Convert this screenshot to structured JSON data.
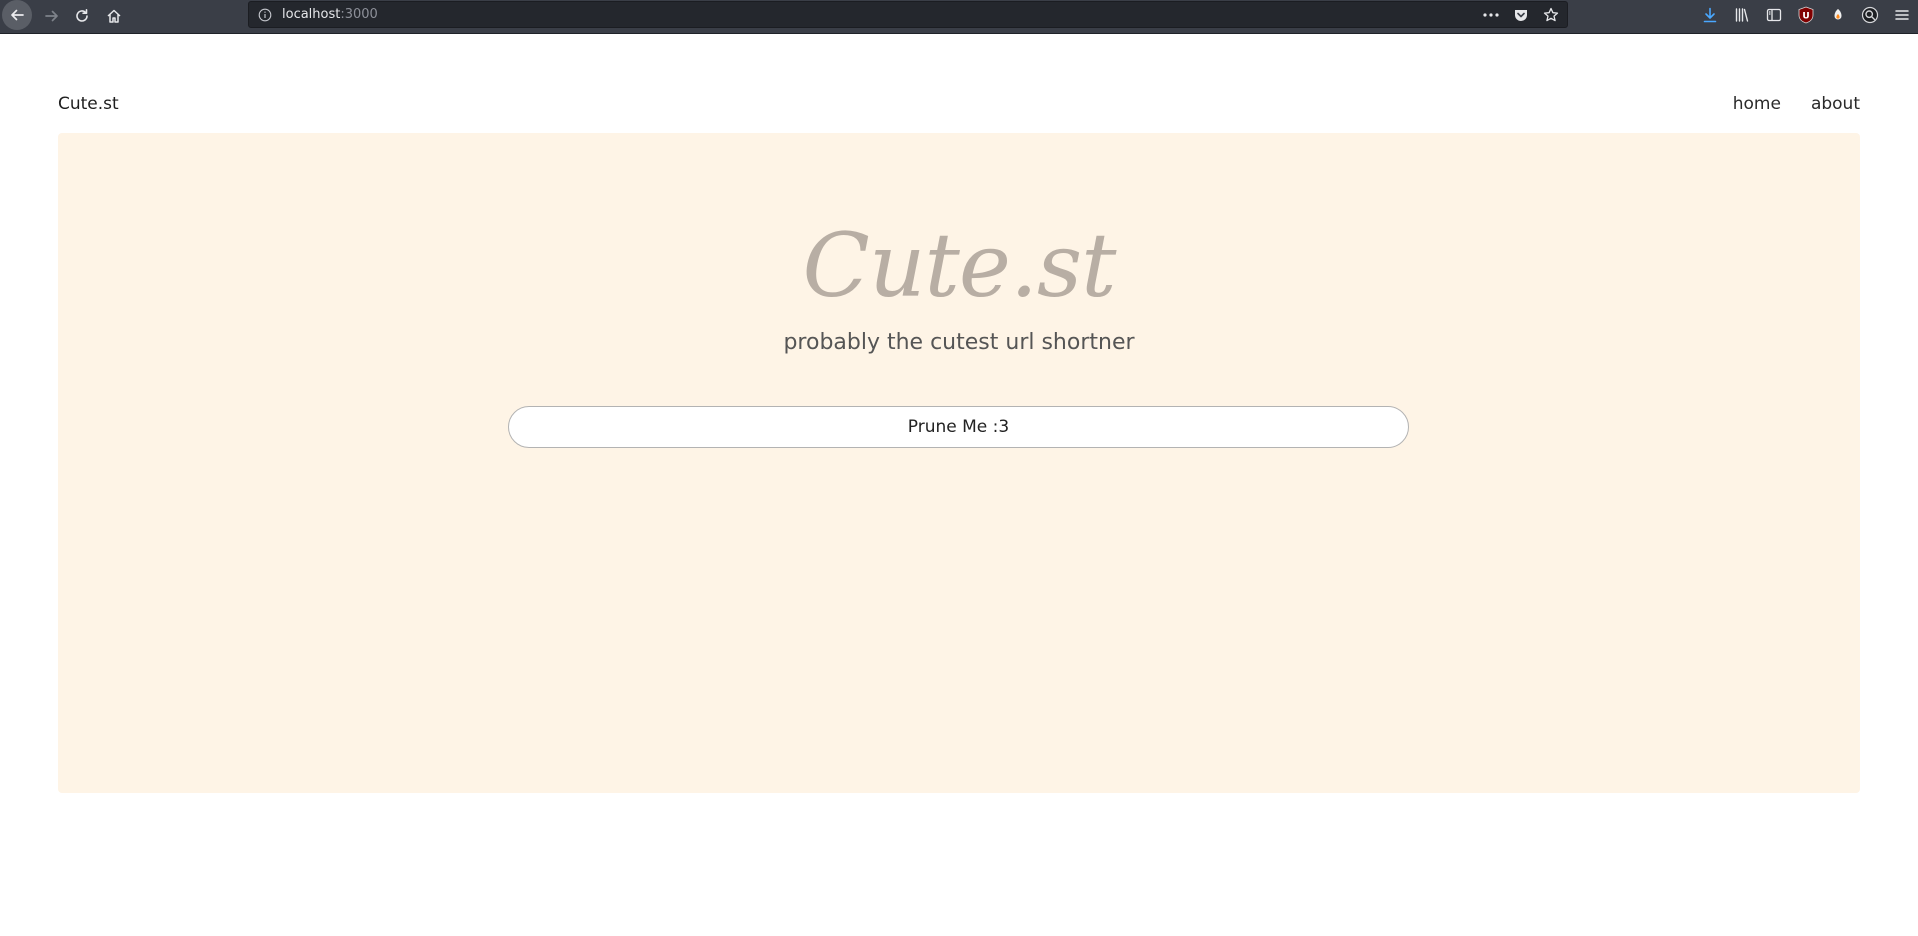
{
  "browser": {
    "url_host": "localhost",
    "url_port": ":3000",
    "icons": {
      "back": "back-arrow-icon",
      "forward": "forward-arrow-icon",
      "reload": "reload-icon",
      "home": "home-icon",
      "info": "info-icon",
      "more": "more-dots-icon",
      "pocket": "pocket-icon",
      "bookmark": "star-icon",
      "download": "download-icon",
      "library": "library-icon",
      "sidebar": "sidebar-icon",
      "ublock": "ublock-icon",
      "extension": "extension-icon",
      "account": "account-icon",
      "menu": "hamburger-menu-icon"
    },
    "ublock_label": "U"
  },
  "header": {
    "brand": "Cute.st",
    "nav": [
      {
        "label": "home"
      },
      {
        "label": "about"
      }
    ]
  },
  "hero": {
    "title": "Cute.st",
    "subtitle": "probably the cutest url shortner",
    "button_label": "Prune Me :3"
  },
  "colors": {
    "toolbar": "#3a3e47",
    "urlbar": "#24272d",
    "hero_background": "#fef4e6",
    "hero_title": "#b8aea4",
    "download_accent": "#4aa8ff",
    "ublock_red": "#800000"
  }
}
